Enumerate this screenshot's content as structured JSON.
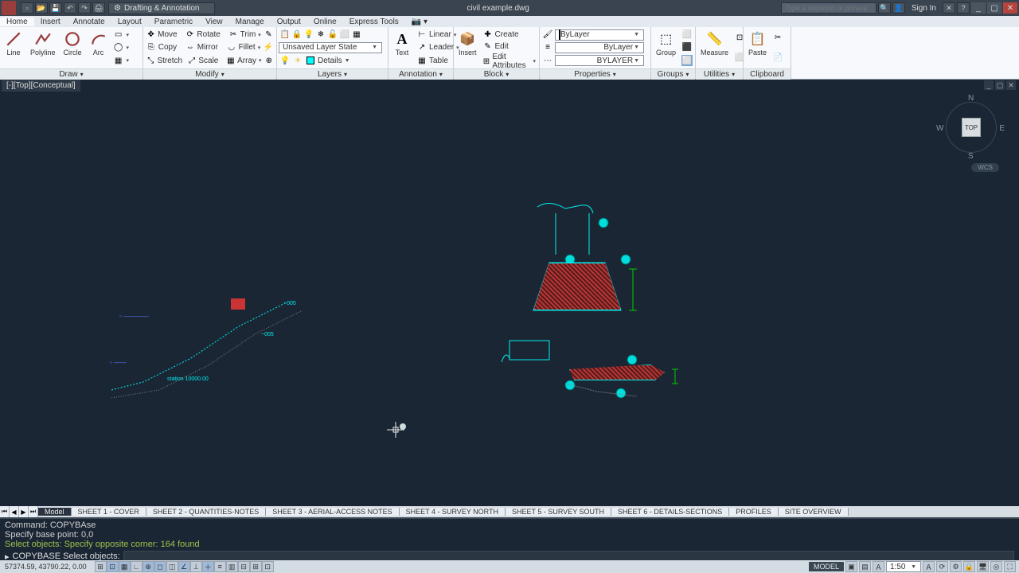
{
  "title": {
    "filename": "civil example.dwg",
    "workspace": "Drafting & Annotation",
    "search_placeholder": "Type a keyword or phrase",
    "signin": "Sign In"
  },
  "tabs": {
    "items": [
      "Home",
      "Insert",
      "Annotate",
      "Layout",
      "Parametric",
      "View",
      "Manage",
      "Output",
      "Online",
      "Express Tools"
    ],
    "active": "Home"
  },
  "ribbon": {
    "draw": {
      "title": "Draw",
      "line": "Line",
      "polyline": "Polyline",
      "circle": "Circle",
      "arc": "Arc"
    },
    "modify": {
      "title": "Modify",
      "move": "Move",
      "rotate": "Rotate",
      "trim": "Trim",
      "copy": "Copy",
      "mirror": "Mirror",
      "fillet": "Fillet",
      "stretch": "Stretch",
      "scale": "Scale",
      "array": "Array"
    },
    "layers": {
      "title": "Layers",
      "state": "Unsaved Layer State",
      "details": "Details"
    },
    "annotation": {
      "title": "Annotation",
      "text": "Text",
      "linear": "Linear",
      "leader": "Leader",
      "table": "Table"
    },
    "block": {
      "title": "Block",
      "insert": "Insert",
      "create": "Create",
      "edit": "Edit",
      "edit_attr": "Edit Attributes"
    },
    "properties": {
      "title": "Properties",
      "bylayer1": "ByLayer",
      "bylayer2": "ByLayer",
      "bylayer3": "BYLAYER"
    },
    "groups": {
      "title": "Groups",
      "group": "Group"
    },
    "utilities": {
      "title": "Utilities",
      "measure": "Measure"
    },
    "clipboard": {
      "title": "Clipboard",
      "paste": "Paste"
    }
  },
  "viewport": {
    "label": "[-][Top][Conceptual]"
  },
  "viewcube": {
    "face": "TOP",
    "n": "N",
    "s": "S",
    "e": "E",
    "w": "W",
    "wcs": "WCS"
  },
  "sheets": {
    "active": "Model",
    "tabs": [
      "SHEET 1 - COVER",
      "SHEET 2 - QUANTITIES-NOTES",
      "SHEET 3 - AERIAL-ACCESS NOTES",
      "SHEET 4 - SURVEY NORTH",
      "SHEET 5 - SURVEY SOUTH",
      "SHEET 6 - DETAILS-SECTIONS",
      "PROFILES",
      "SITE OVERVIEW"
    ]
  },
  "command": {
    "hist1": "Command: COPYBAse",
    "hist2": "Specify base point: 0,0",
    "hist3": "Select objects: Specify opposite corner: 164 found",
    "prompt": "COPYBASE Select objects:"
  },
  "status": {
    "coords": "57374.59, 43790.22, 0.00",
    "model": "MODEL",
    "scale": "1:50"
  }
}
